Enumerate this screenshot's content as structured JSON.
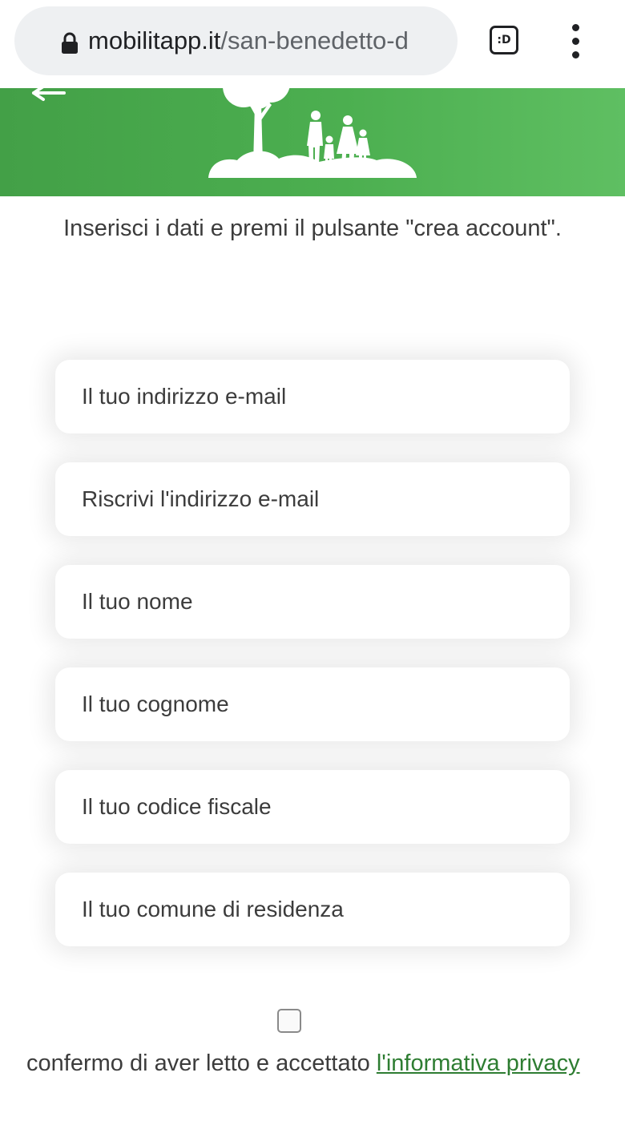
{
  "browser": {
    "url_host": "mobilitapp.it",
    "url_path": "/san-benedetto-d",
    "tab_switcher_label": ":D",
    "lock_icon": "lock-icon",
    "menu_icon": "more-vert-icon"
  },
  "header": {
    "back_icon": "back-arrow-icon",
    "illustration": "family-tree-illustration",
    "colors": {
      "green_start": "#43a047",
      "green_end": "#5fbf62"
    }
  },
  "form": {
    "intro": "Inserisci i dati e premi il pulsante \"crea account\".",
    "fields": [
      {
        "placeholder": "Il tuo indirizzo e-mail"
      },
      {
        "placeholder": "Riscrivi l'indirizzo e-mail"
      },
      {
        "placeholder": "Il tuo nome"
      },
      {
        "placeholder": "Il tuo cognome"
      },
      {
        "placeholder": "Il tuo codice fiscale"
      },
      {
        "placeholder": "Il tuo comune di residenza"
      }
    ],
    "consent": {
      "text": "confermo di aver letto e accettato ",
      "link": "l'informativa privacy",
      "checked": false
    }
  }
}
